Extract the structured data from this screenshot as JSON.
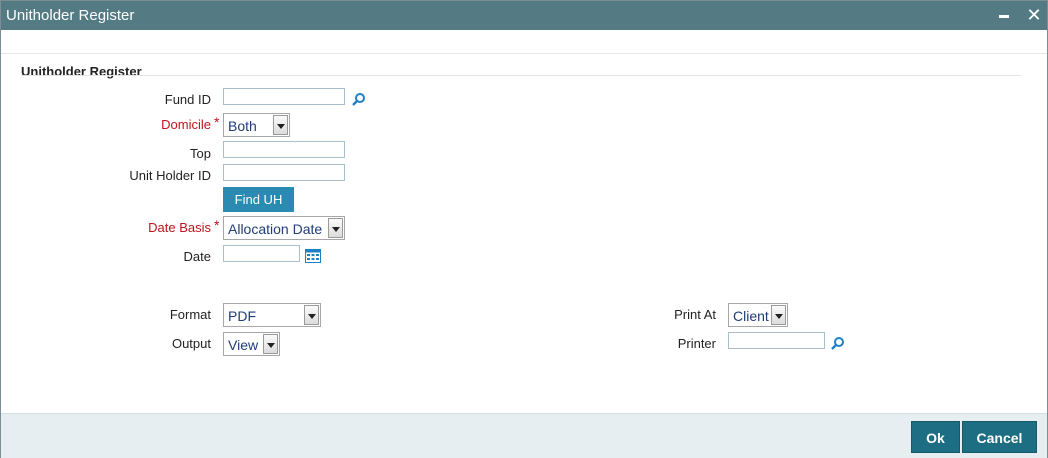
{
  "window": {
    "title": "Unitholder Register"
  },
  "section": {
    "title": "Unitholder Register"
  },
  "fields": {
    "fund_id": {
      "label": "Fund ID",
      "value": ""
    },
    "domicile": {
      "label": "Domicile",
      "required_mark": "*",
      "value": "Both"
    },
    "top": {
      "label": "Top",
      "value": ""
    },
    "unit_holder_id": {
      "label": "Unit Holder ID",
      "value": ""
    },
    "find_uh": {
      "label": "Find UH"
    },
    "date_basis": {
      "label": "Date Basis",
      "required_mark": "*",
      "value": "Allocation Date"
    },
    "date": {
      "label": "Date",
      "value": ""
    },
    "format": {
      "label": "Format",
      "value": "PDF"
    },
    "output": {
      "label": "Output",
      "value": "View"
    },
    "print_at": {
      "label": "Print At",
      "value": "Client"
    },
    "printer": {
      "label": "Printer",
      "value": ""
    }
  },
  "footer": {
    "ok_label": "Ok",
    "cancel_label": "Cancel"
  },
  "colors": {
    "titlebar": "#547a83",
    "required": "#c0141e",
    "primary_button": "#1d6e82",
    "find_button": "#2a8ab2",
    "icon_blue": "#1f7fc4"
  },
  "icons": {
    "minimize": "minimize-icon",
    "close": "close-icon",
    "search": "search-icon",
    "calendar": "calendar-icon",
    "dropdown": "chevron-down-icon"
  }
}
